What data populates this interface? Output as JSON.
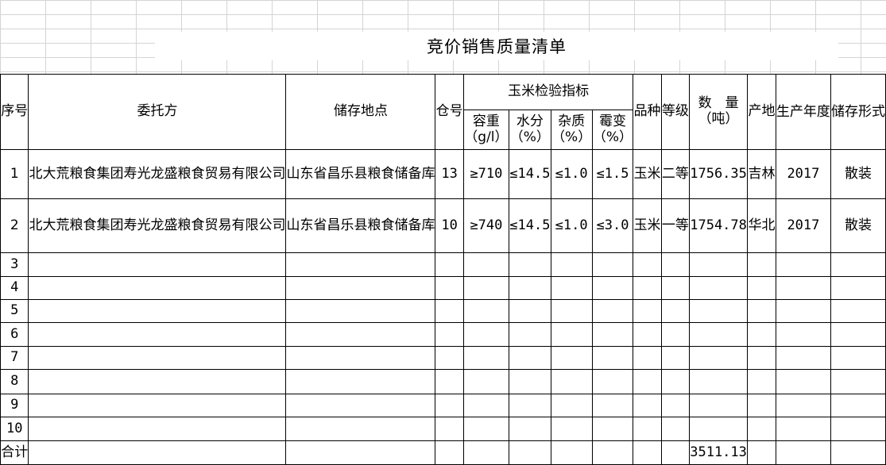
{
  "sheet": {
    "title": "竞价销售质量清单",
    "headers": {
      "seq": "序号",
      "client": "委托方",
      "location": "储存地点",
      "bin": "仓号",
      "inspection_group": "玉米检验指标",
      "density": "容重",
      "density_unit": "（g/l）",
      "moisture": "水分",
      "moisture_unit": "（%）",
      "impurity": "杂质",
      "impurity_unit": "（%）",
      "mildew": "霉变",
      "mildew_unit": "（%）",
      "variety": "品种",
      "grade": "等级",
      "quantity": "数　量",
      "quantity_unit": "（吨）",
      "origin": "产地",
      "year": "生产年度",
      "storage": "储存形式"
    },
    "rows": [
      {
        "seq": "1",
        "client": "北大荒粮食集团寿光龙盛粮食贸易有限公司",
        "location": "山东省昌乐县粮食储备库",
        "bin": "13",
        "density": "≥710",
        "moisture": "≤14.5",
        "impurity": "≤1.0",
        "mildew": "≤1.5",
        "variety": "玉米",
        "grade": "二等",
        "quantity": "1756.35",
        "origin": "吉林",
        "year": "2017",
        "storage": "散装"
      },
      {
        "seq": "2",
        "client": "北大荒粮食集团寿光龙盛粮食贸易有限公司",
        "location": "山东省昌乐县粮食储备库",
        "bin": "10",
        "density": "≥740",
        "moisture": "≤14.5",
        "impurity": "≤1.0",
        "mildew": "≤3.0",
        "variety": "玉米",
        "grade": "一等",
        "quantity": "1754.78",
        "origin": "华北",
        "year": "2017",
        "storage": "散装"
      }
    ],
    "empty_rows": [
      "3",
      "4",
      "5",
      "6",
      "7",
      "8",
      "9",
      "10"
    ],
    "total_label": "合计",
    "total_quantity": "3511.13"
  }
}
